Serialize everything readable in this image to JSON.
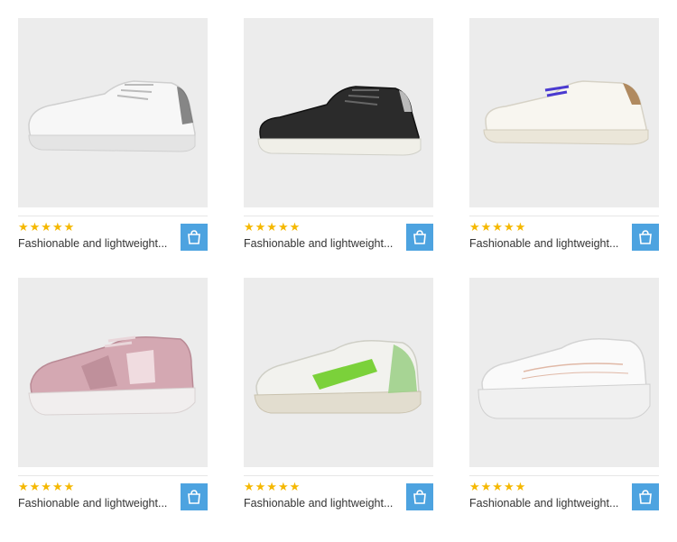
{
  "products": [
    {
      "rating": "★★★★★",
      "title": "Fashionable and lightweight...",
      "cart_icon": "shopping-bag-icon",
      "image": "white-sneaker"
    },
    {
      "rating": "★★★★★",
      "title": "Fashionable and lightweight...",
      "cart_icon": "shopping-bag-icon",
      "image": "black-sneaker"
    },
    {
      "rating": "★★★★★",
      "title": "Fashionable and lightweight...",
      "cart_icon": "shopping-bag-icon",
      "image": "white-tan-sneaker"
    },
    {
      "rating": "★★★★★",
      "title": "Fashionable and lightweight...",
      "cart_icon": "shopping-bag-icon",
      "image": "pink-running-shoe"
    },
    {
      "rating": "★★★★★",
      "title": "Fashionable and lightweight...",
      "cart_icon": "shopping-bag-icon",
      "image": "white-green-sneaker"
    },
    {
      "rating": "★★★★★",
      "title": "Fashionable and lightweight...",
      "cart_icon": "shopping-bag-icon",
      "image": "white-chunky-sneaker"
    }
  ],
  "colors": {
    "image_bg": "#ececec",
    "star": "#f5b800",
    "cart_button": "#4da3e0",
    "shoe_pink": "#c99aa5",
    "shoe_black": "#2b2b2b",
    "shoe_green": "#7bd13a",
    "shoe_tan": "#b08a60"
  }
}
